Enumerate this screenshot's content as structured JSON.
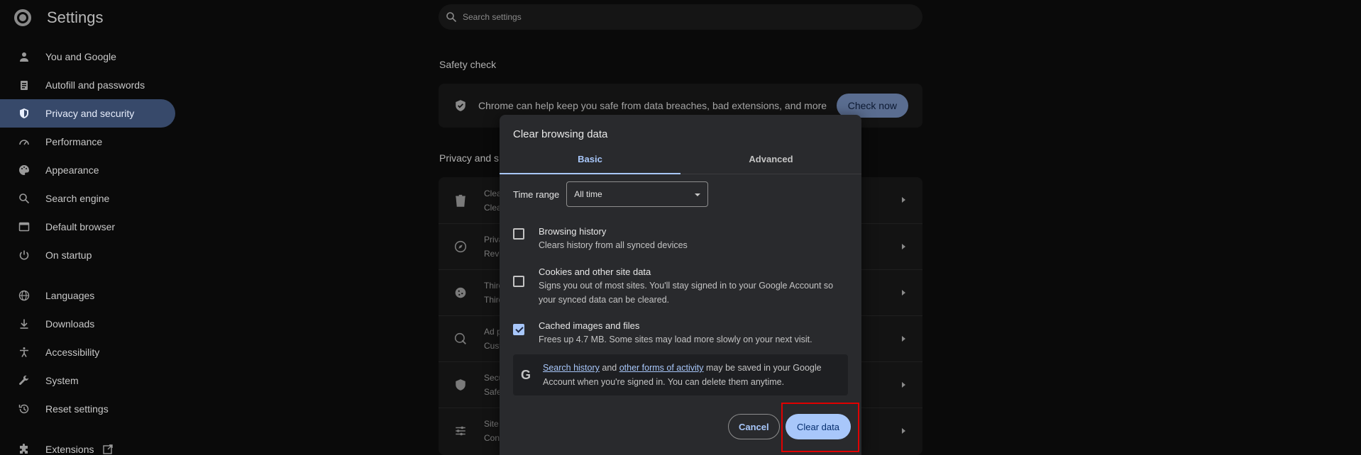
{
  "sidebar": {
    "title": "Settings",
    "items": [
      {
        "label": "You and Google",
        "icon": "person-icon"
      },
      {
        "label": "Autofill and passwords",
        "icon": "clipboard-icon"
      },
      {
        "label": "Privacy and security",
        "icon": "shield-icon",
        "active": true
      },
      {
        "label": "Performance",
        "icon": "speedometer-icon"
      },
      {
        "label": "Appearance",
        "icon": "palette-icon"
      },
      {
        "label": "Search engine",
        "icon": "search-icon"
      },
      {
        "label": "Default browser",
        "icon": "browser-icon"
      },
      {
        "label": "On startup",
        "icon": "power-icon"
      },
      {
        "label": "Languages",
        "icon": "globe-icon"
      },
      {
        "label": "Downloads",
        "icon": "download-icon"
      },
      {
        "label": "Accessibility",
        "icon": "accessibility-icon"
      },
      {
        "label": "System",
        "icon": "wrench-icon"
      },
      {
        "label": "Reset settings",
        "icon": "history-icon"
      },
      {
        "label": "Extensions",
        "icon": "puzzle-icon"
      }
    ]
  },
  "search": {
    "placeholder": "Search settings"
  },
  "safety_check": {
    "heading": "Safety check",
    "text": "Chrome can help keep you safe from data breaches, bad extensions, and more",
    "button": "Check now"
  },
  "privacy": {
    "heading": "Privacy and s",
    "rows": [
      {
        "title": "Clear",
        "subtitle": "Clear",
        "icon": "trash-icon"
      },
      {
        "title": "Priva",
        "subtitle": "Revie",
        "icon": "compass-icon"
      },
      {
        "title": "Third",
        "subtitle": "Third",
        "icon": "cookie-icon"
      },
      {
        "title": "Ad p",
        "subtitle": "Custo",
        "icon": "ad-icon"
      },
      {
        "title": "Secu",
        "subtitle": "Safe",
        "icon": "shield-icon"
      },
      {
        "title": "Site s",
        "subtitle": "Cont",
        "icon": "sliders-icon"
      }
    ]
  },
  "dialog": {
    "title": "Clear browsing data",
    "tabs": [
      "Basic",
      "Advanced"
    ],
    "active_tab": "Basic",
    "time_range_label": "Time range",
    "time_range_value": "All time",
    "options": [
      {
        "title": "Browsing history",
        "desc": "Clears history from all synced devices",
        "checked": false
      },
      {
        "title": "Cookies and other site data",
        "desc": "Signs you out of most sites. You'll stay signed in to your Google Account so your synced data can be cleared.",
        "checked": false
      },
      {
        "title": "Cached images and files",
        "desc": "Frees up 4.7 MB. Some sites may load more slowly on your next visit.",
        "checked": true
      }
    ],
    "info": {
      "link1": "Search history",
      "and": " and ",
      "link2": "other forms of activity",
      "rest": " may be saved in your Google Account when you're signed in. You can delete them anytime."
    },
    "cancel_label": "Cancel",
    "clear_label": "Clear data"
  },
  "colors": {
    "accent": "#a8c7fa",
    "active_nav": "#37496a",
    "dialog_bg": "#292a2d",
    "highlight": "#e00000"
  }
}
